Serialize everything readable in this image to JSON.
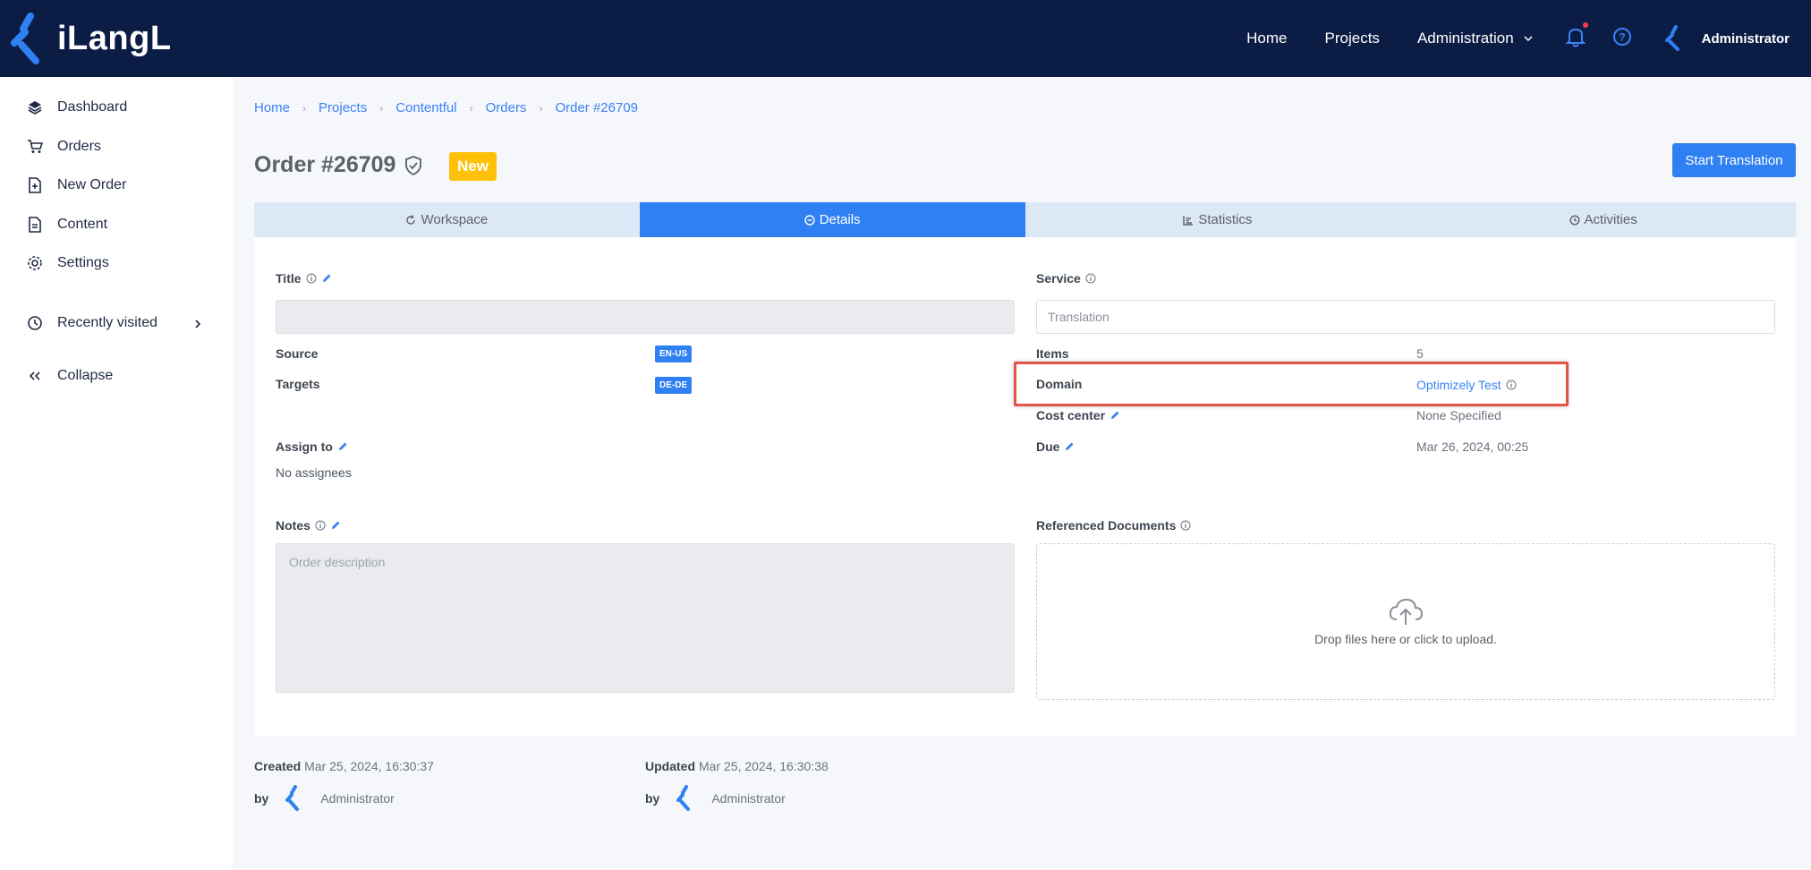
{
  "app": {
    "logo_text": "iLangL"
  },
  "topnav": {
    "home": "Home",
    "projects": "Projects",
    "administration": "Administration",
    "user": "Administrator"
  },
  "sidebar": {
    "items": [
      {
        "label": "Dashboard",
        "icon": "layers-icon"
      },
      {
        "label": "Orders",
        "icon": "cart-icon"
      },
      {
        "label": "New Order",
        "icon": "new-file-icon"
      },
      {
        "label": "Content",
        "icon": "document-icon"
      },
      {
        "label": "Settings",
        "icon": "gear-icon"
      },
      {
        "label": "Recently visited",
        "icon": "history-icon"
      },
      {
        "label": "Collapse",
        "icon": "double-chevron-left-icon"
      }
    ]
  },
  "breadcrumb": [
    "Home",
    "Projects",
    "Contentful",
    "Orders",
    "Order #26709"
  ],
  "page": {
    "title": "Order #26709",
    "status_badge": "New",
    "start_button": "Start Translation"
  },
  "tabs": [
    "Workspace",
    "Details",
    "Statistics",
    "Activities"
  ],
  "active_tab": "Details",
  "details": {
    "title_label": "Title",
    "title_value": "",
    "service_label": "Service",
    "service_value": "Translation",
    "source_label": "Source",
    "source_value": "EN-US",
    "targets_label": "Targets",
    "targets_value": "DE-DE",
    "items_label": "Items",
    "items_value": "5",
    "domain_label": "Domain",
    "domain_value": "Optimizely Test",
    "cost_center_label": "Cost center",
    "cost_center_value": "None Specified",
    "assign_label": "Assign to",
    "assign_value": "No assignees",
    "due_label": "Due",
    "due_value": "Mar 26, 2024, 00:25",
    "notes_label": "Notes",
    "notes_placeholder": "Order description",
    "refdocs_label": "Referenced Documents",
    "dropzone_text": "Drop files here or click to upload."
  },
  "footer": {
    "created_label": "Created",
    "created_value": "Mar 25, 2024, 16:30:37",
    "updated_label": "Updated",
    "updated_value": "Mar 25, 2024, 16:30:38",
    "by_label": "by",
    "created_by": "Administrator",
    "updated_by": "Administrator"
  },
  "colors": {
    "topbar": "#0b1d45",
    "accent": "#2f80f2",
    "badge": "#ffc107",
    "highlight": "#e05545"
  }
}
